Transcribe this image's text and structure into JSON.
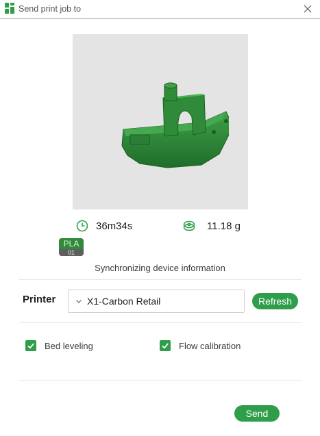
{
  "window": {
    "title": "Send print job to",
    "icon": "app-logo-icon"
  },
  "preview": {
    "subject": "boat-model-icon",
    "model_color": "#2e8b3a",
    "background": "#e4e4e4"
  },
  "stats": {
    "print_time": "36m34s",
    "print_time_icon": "clock-icon",
    "weight": "11.18 g",
    "weight_icon": "filament-spool-icon"
  },
  "filament": {
    "type": "PLA",
    "slot": "01",
    "color": "#2f8a3a"
  },
  "status": {
    "message": "Synchronizing device information"
  },
  "printer": {
    "label": "Printer",
    "selected": "X1-Carbon Retail",
    "refresh_label": "Refresh"
  },
  "options": {
    "bed_leveling": {
      "label": "Bed leveling",
      "checked": true
    },
    "flow_calibration": {
      "label": "Flow calibration",
      "checked": true
    }
  },
  "actions": {
    "send_label": "Send"
  },
  "colors": {
    "accent": "#2f9e4a"
  }
}
